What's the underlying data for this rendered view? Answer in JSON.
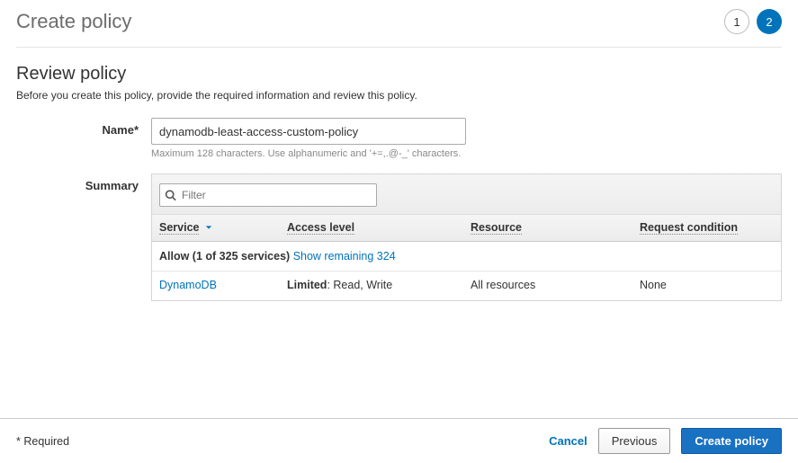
{
  "header": {
    "title": "Create policy",
    "steps": {
      "one": "1",
      "two": "2",
      "active": 2
    }
  },
  "review": {
    "title": "Review policy",
    "subtitle": "Before you create this policy, provide the required information and review this policy."
  },
  "name": {
    "label": "Name*",
    "value": "dynamodb-least-access-custom-policy",
    "hint": "Maximum 128 characters. Use alphanumeric and '+=,.@-_' characters."
  },
  "summary": {
    "label": "Summary",
    "filter_placeholder": "Filter",
    "columns": {
      "service": "Service",
      "access": "Access level",
      "resource": "Resource",
      "condition": "Request condition"
    },
    "allow_text_strong": "Allow (1 of 325 services)",
    "show_remaining": "Show remaining 324",
    "row": {
      "service": "DynamoDB",
      "access_prefix": "Limited",
      "access_rest": ": Read, Write",
      "resource": "All resources",
      "condition": "None"
    }
  },
  "footer": {
    "required": "* Required",
    "cancel": "Cancel",
    "previous": "Previous",
    "create": "Create policy"
  }
}
